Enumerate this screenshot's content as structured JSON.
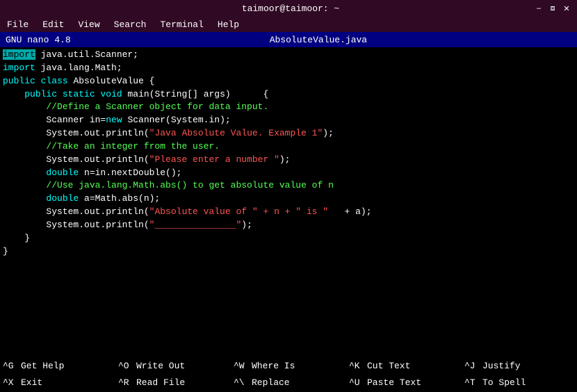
{
  "titlebar": {
    "title": "taimoor@taimoor: ~",
    "minimize": "–",
    "restore": "❐",
    "close": "✕"
  },
  "menubar": {
    "items": [
      "File",
      "Edit",
      "View",
      "Search",
      "Terminal",
      "Help"
    ]
  },
  "nano": {
    "left": "GNU nano 4.8",
    "center": "AbsoluteValue.java"
  },
  "shortcuts": [
    [
      {
        "key": "^G",
        "label": "Get Help"
      },
      {
        "key": "^X",
        "label": "Exit"
      }
    ],
    [
      {
        "key": "^O",
        "label": "Write Out"
      },
      {
        "key": "^R",
        "label": "Read File"
      }
    ],
    [
      {
        "key": "^W",
        "label": "Where Is"
      },
      {
        "key": "^\\",
        "label": "Replace"
      }
    ],
    [
      {
        "key": "^K",
        "label": "Cut Text"
      },
      {
        "key": "^U",
        "label": "Paste Text"
      }
    ],
    [
      {
        "key": "^J",
        "label": "Justify"
      },
      {
        "key": "^T",
        "label": "To Spell"
      }
    ]
  ]
}
